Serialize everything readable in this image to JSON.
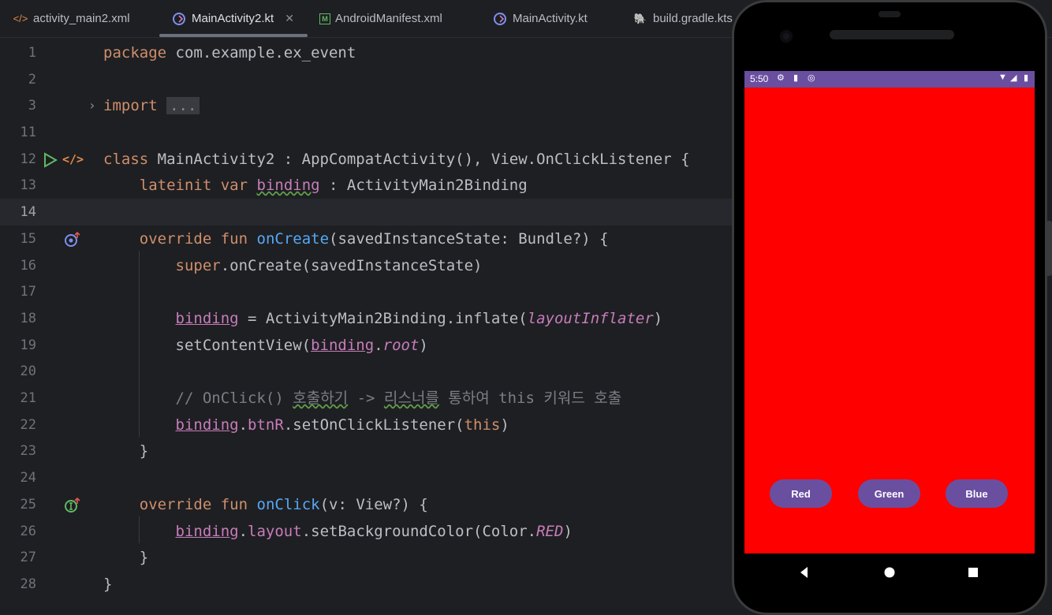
{
  "tabs": [
    {
      "label": "activity_main2.xml",
      "icon": "xml-icon"
    },
    {
      "label": "MainActivity2.kt",
      "icon": "kotlin-file-icon",
      "active": true
    },
    {
      "label": "AndroidManifest.xml",
      "icon": "manifest-icon"
    },
    {
      "label": "MainActivity.kt",
      "icon": "kotlin-file-icon"
    },
    {
      "label": "build.gradle.kts",
      "icon": "gradle-icon"
    }
  ],
  "editor": {
    "line_numbers": [
      "1",
      "2",
      "3",
      "11",
      "12",
      "13",
      "14",
      "15",
      "16",
      "17",
      "18",
      "19",
      "20",
      "21",
      "22",
      "23",
      "24",
      "25",
      "26",
      "27",
      "28"
    ],
    "current_line": "14",
    "code": {
      "l1_kw": "package",
      "l1_rest": " com.example.ex_event",
      "l3_kw": "import",
      "l3_fold": "...",
      "l12_kw": "class",
      "l12_rest": " MainActivity2 : AppCompatActivity(), View.OnClickListener {",
      "l13_kw": "lateinit var",
      "l13_prop": "binding",
      "l13_rest": " : ActivityMain2Binding",
      "l15_kw": "override fun",
      "l15_fn": "onCreate",
      "l15_rest": "(savedInstanceState: Bundle?) {",
      "l16_kw": "super",
      "l16_rest": ".onCreate(savedInstanceState)",
      "l18_prop": "binding",
      "l18_mid": " = ActivityMain2Binding.inflate(",
      "l18_it": "layoutInflater",
      "l18_end": ")",
      "l19_pre": "setContentView(",
      "l19_prop": "binding",
      "l19_dot": ".",
      "l19_it": "root",
      "l19_end": ")",
      "l21_pre": "// OnClick() ",
      "l21_w1": "호출하기",
      "l21_mid": " -> ",
      "l21_w2": "리스너를",
      "l21_end": " 통하여 this 키워드 호출",
      "l22_prop": "binding",
      "l22_dot": ".",
      "l22_prop2": "btnR",
      "l22_mid": ".setOnClickListener(",
      "l22_kw": "this",
      "l22_end": ")",
      "l23": "}",
      "l25_kw": "override fun",
      "l25_fn": "onClick",
      "l25_rest": "(v: View?) {",
      "l26_prop": "binding",
      "l26_dot": ".",
      "l26_prop2": "layout",
      "l26_mid": ".setBackgroundColor(Color.",
      "l26_it": "RED",
      "l26_end": ")",
      "l27": "}",
      "l28": "}"
    }
  },
  "emulator": {
    "status_time": "5:50",
    "screen_color": "#ff0000",
    "buttons": [
      "Red",
      "Green",
      "Blue"
    ],
    "accent": "#6a4fa0"
  }
}
